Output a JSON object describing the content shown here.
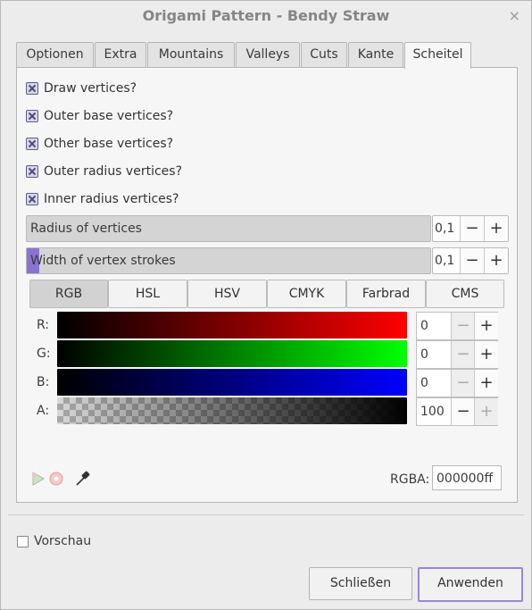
{
  "window": {
    "title": "Origami Pattern - Bendy Straw",
    "close_glyph": "×"
  },
  "tabs": [
    {
      "label": "Optionen",
      "active": false
    },
    {
      "label": "Extra",
      "active": false
    },
    {
      "label": "Mountains",
      "active": false
    },
    {
      "label": "Valleys",
      "active": false
    },
    {
      "label": "Cuts",
      "active": false
    },
    {
      "label": "Kante",
      "active": false
    },
    {
      "label": "Scheitel",
      "active": true
    }
  ],
  "checkboxes": [
    {
      "label": "Draw vertices?",
      "checked": true
    },
    {
      "label": "Outer base vertices?",
      "checked": true
    },
    {
      "label": "Other base vertices?",
      "checked": true
    },
    {
      "label": "Outer radius vertices?",
      "checked": true
    },
    {
      "label": "Inner radius vertices?",
      "checked": true
    }
  ],
  "sliders": [
    {
      "label": "Radius of vertices",
      "value": "0,1",
      "fill_fraction": 0
    },
    {
      "label": "Width of vertex strokes",
      "value": "0,1",
      "fill_fraction": 0.03
    }
  ],
  "spin_glyphs": {
    "minus": "−",
    "plus": "+"
  },
  "color_modes": [
    {
      "label": "RGB",
      "active": true
    },
    {
      "label": "HSL",
      "active": false
    },
    {
      "label": "HSV",
      "active": false
    },
    {
      "label": "CMYK",
      "active": false
    },
    {
      "label": "Farbrad",
      "active": false
    },
    {
      "label": "CMS",
      "active": false
    }
  ],
  "channels": [
    {
      "label": "R:",
      "value": "0",
      "color": "#ff0000"
    },
    {
      "label": "G:",
      "value": "0",
      "color": "#00ff00"
    },
    {
      "label": "B:",
      "value": "0",
      "color": "#0000ff"
    },
    {
      "label": "A:",
      "value": "100",
      "color": "#000000"
    }
  ],
  "rgba": {
    "label": "RGBA:",
    "value": "000000ff"
  },
  "preview": {
    "label": "Vorschau",
    "checked": false
  },
  "buttons": {
    "close": "Schließen",
    "apply": "Anwenden"
  },
  "accent_color": "#8a72d4"
}
